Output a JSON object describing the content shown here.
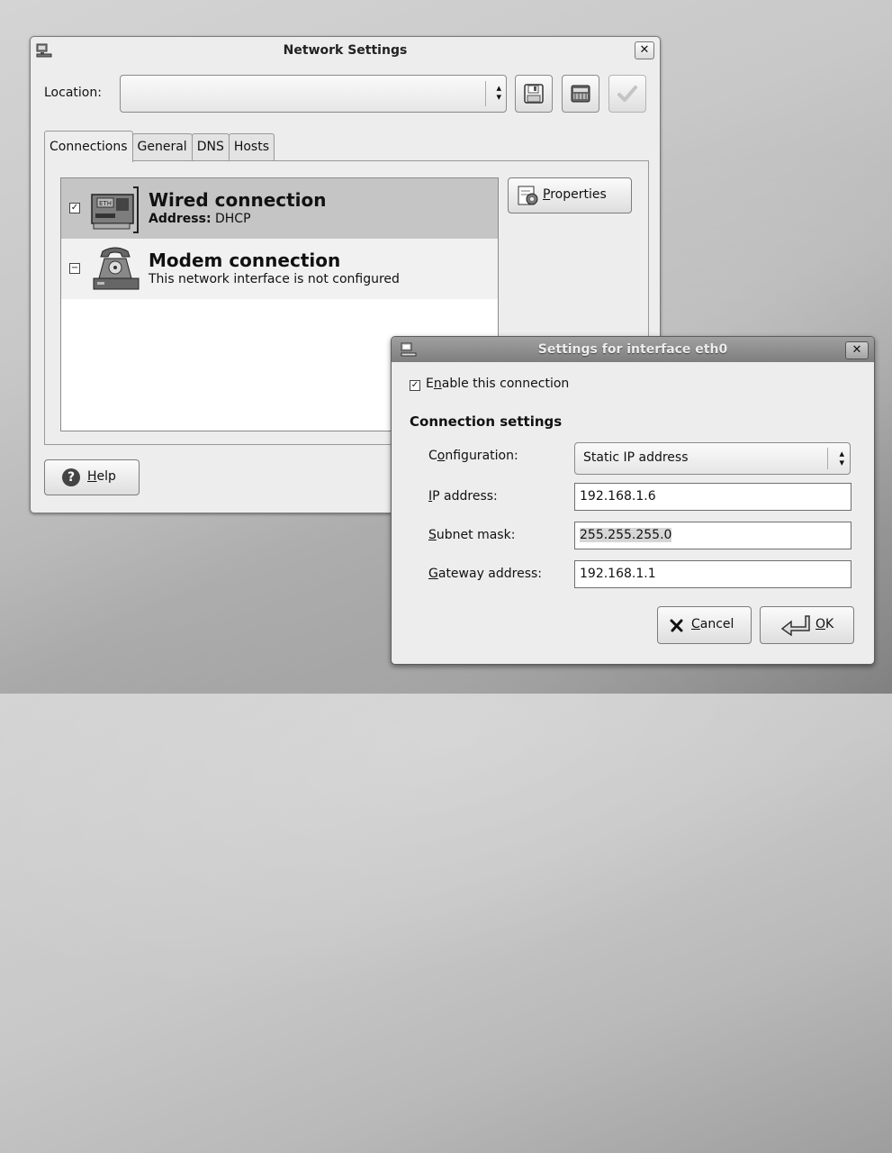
{
  "main_window": {
    "title": "Network Settings",
    "location_label": "Location:",
    "location_value": "",
    "tabs": [
      "Connections",
      "General",
      "DNS",
      "Hosts"
    ],
    "interfaces": [
      {
        "name": "Wired connection",
        "detail_key": "Address:",
        "detail_value": " DHCP",
        "enabled": true
      },
      {
        "name": "Modem connection",
        "detail": "This network interface is not configured",
        "enabled": false
      }
    ],
    "properties_prefix": "P",
    "properties_rest": "roperties",
    "help_prefix": "H",
    "help_rest": "elp"
  },
  "dialog": {
    "title": "Settings for interface eth0",
    "enable_pre": "E",
    "enable_u": "n",
    "enable_rest": "able this connection",
    "enabled": true,
    "section_title": "Connection settings",
    "config_pre": "C",
    "config_u": "o",
    "config_rest": "nfiguration:",
    "config_value": "Static IP address",
    "ip_u": "I",
    "ip_rest": "P address:",
    "ip_value": "192.168.1.6",
    "subnet_u": "S",
    "subnet_rest": "ubnet mask:",
    "subnet_value": "255.255.255.0",
    "gateway_u": "G",
    "gateway_rest": "ateway address:",
    "gateway_value": "192.168.1.1",
    "cancel_u": "C",
    "cancel_rest": "ancel",
    "ok_u": "O",
    "ok_rest": "K"
  }
}
